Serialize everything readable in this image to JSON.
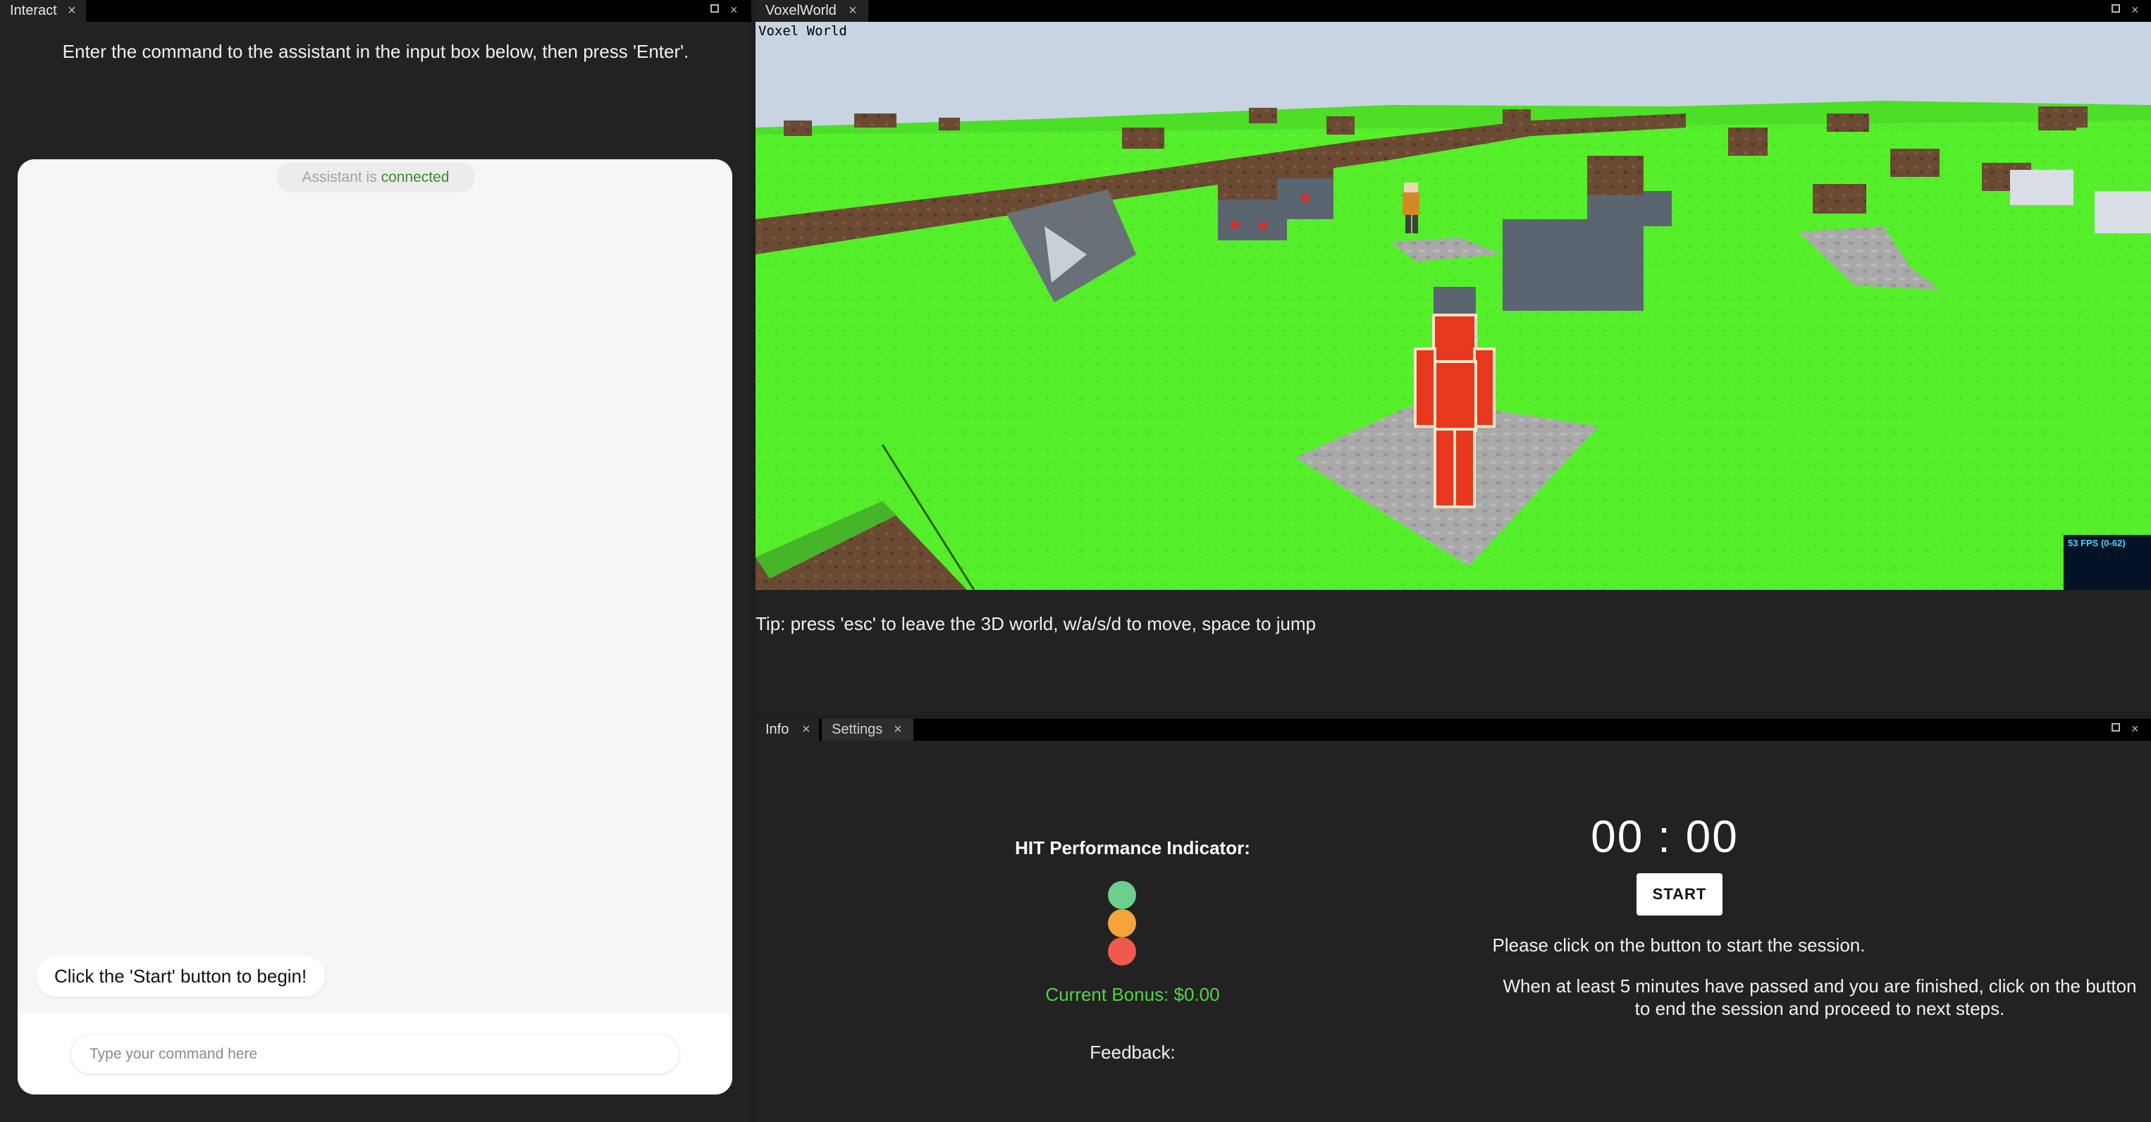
{
  "left_panel": {
    "tab_label": "Interact",
    "instruction": "Enter the command to the assistant in the input box below, then press 'Enter'.",
    "status_prefix": "Assistant is",
    "status_value": "connected",
    "bot_message": "Click the 'Start' button to begin!",
    "input_placeholder": "Type your command here"
  },
  "world_panel": {
    "tab_label": "VoxelWorld",
    "viewport_label": "Voxel World",
    "fps_text": "53 FPS (0-62)",
    "tip": "Tip: press 'esc' to leave the 3D world, w/a/s/d to move, space to jump"
  },
  "info_panel": {
    "tabs": [
      {
        "label": "Info",
        "active": true
      },
      {
        "label": "Settings",
        "active": false
      }
    ],
    "hit_title": "HIT Performance Indicator:",
    "lights": [
      "#6ccf8f",
      "#f5a43a",
      "#f0594b"
    ],
    "bonus": "Current Bonus: $0.00",
    "feedback_label": "Feedback:",
    "timer": "00 : 00",
    "start_label": "START",
    "message1": "Please click on the button to start the session.",
    "message2": "When at least 5 minutes have passed and you are finished, click on the button to end the session and proceed to next steps."
  },
  "icons": {
    "close": "×",
    "maximize": "maximize-icon"
  }
}
